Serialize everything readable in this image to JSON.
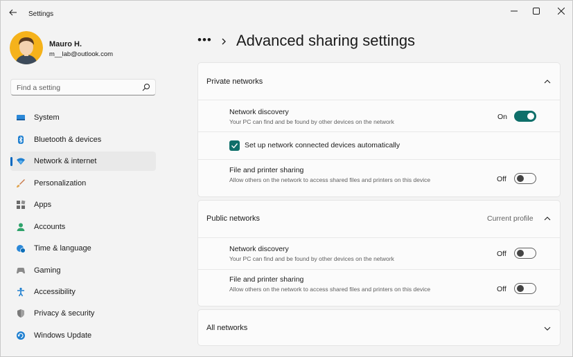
{
  "window": {
    "title": "Settings"
  },
  "user": {
    "name": "Mauro H.",
    "email": "m__lab@outlook.com"
  },
  "search": {
    "placeholder": "Find a setting"
  },
  "sidebar": {
    "items": [
      {
        "label": "System",
        "icon": "system-icon"
      },
      {
        "label": "Bluetooth & devices",
        "icon": "bluetooth-icon"
      },
      {
        "label": "Network & internet",
        "icon": "network-icon",
        "active": true
      },
      {
        "label": "Personalization",
        "icon": "brush-icon"
      },
      {
        "label": "Apps",
        "icon": "apps-icon"
      },
      {
        "label": "Accounts",
        "icon": "accounts-icon"
      },
      {
        "label": "Time & language",
        "icon": "globe-clock-icon"
      },
      {
        "label": "Gaming",
        "icon": "gamepad-icon"
      },
      {
        "label": "Accessibility",
        "icon": "accessibility-icon"
      },
      {
        "label": "Privacy & security",
        "icon": "shield-icon"
      },
      {
        "label": "Windows Update",
        "icon": "update-icon"
      }
    ]
  },
  "header": {
    "breadcrumb_more": "•••",
    "title": "Advanced sharing settings"
  },
  "private": {
    "title": "Private networks",
    "discovery": {
      "title": "Network discovery",
      "desc": "Your PC can find and be found by other devices on the network",
      "state": "On"
    },
    "auto_setup": {
      "label": "Set up network connected devices automatically",
      "checked": true
    },
    "sharing": {
      "title": "File and printer sharing",
      "desc": "Allow others on the network to access shared files and printers on this device",
      "state": "Off"
    }
  },
  "public": {
    "title": "Public networks",
    "badge": "Current profile",
    "discovery": {
      "title": "Network discovery",
      "desc": "Your PC can find and be found by other devices on the network",
      "state": "Off"
    },
    "sharing": {
      "title": "File and printer sharing",
      "desc": "Allow others on the network to access shared files and printers on this device",
      "state": "Off"
    }
  },
  "all": {
    "title": "All networks"
  },
  "colors": {
    "accent": "#0067c0",
    "toggle_on": "#0f6f6a"
  }
}
